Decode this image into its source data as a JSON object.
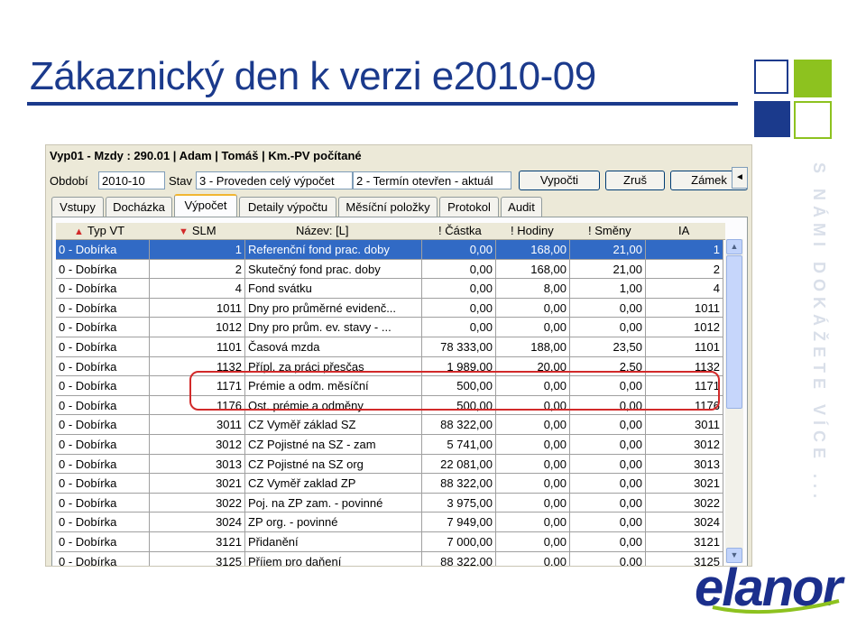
{
  "slide": {
    "title": "Zákaznický den k verzi e2010-09",
    "side_text": "S NÁMI DOKÁŽETE VÍCE ...",
    "logo_text": "elanor",
    "colors": {
      "title": "#1b3a8c",
      "green": "#8dc21f",
      "navy": "#1b3a8c"
    }
  },
  "app": {
    "title": "Vyp01 - Mzdy : 290.01 | Adam | Tomáš | Km.-PV počítané",
    "period_label": "Období",
    "period_value": "2010-10",
    "state_label": "Stav",
    "state_value": "3 - Proveden celý výpočet",
    "term_value": "2 - Termín otevřen - aktuál",
    "buttons": {
      "calc": "Vypočti",
      "cancel": "Zruš",
      "lock": "Zámek"
    },
    "tabs": [
      "Vstupy",
      "Docházka",
      "Výpočet",
      "Detaily výpočtu",
      "Měsíční položky",
      "Protokol",
      "Audit"
    ],
    "active_tab": "Výpočet",
    "columns": [
      "Typ VT",
      "SLM",
      "Název: [L]",
      "! Částka",
      "! Hodiny",
      "! Směny",
      "IA"
    ],
    "rows": [
      [
        "0 - Dobírka",
        "1",
        "Referenční fond prac. doby",
        "0,00",
        "168,00",
        "21,00",
        "1"
      ],
      [
        "0 - Dobírka",
        "2",
        "Skutečný fond prac. doby",
        "0,00",
        "168,00",
        "21,00",
        "2"
      ],
      [
        "0 - Dobírka",
        "4",
        "Fond svátku",
        "0,00",
        "8,00",
        "1,00",
        "4"
      ],
      [
        "0 - Dobírka",
        "1011",
        "Dny pro průměrné evidenč...",
        "0,00",
        "0,00",
        "0,00",
        "1011"
      ],
      [
        "0 - Dobírka",
        "1012",
        "Dny pro prům. ev. stavy - ...",
        "0,00",
        "0,00",
        "0,00",
        "1012"
      ],
      [
        "0 - Dobírka",
        "1101",
        "Časová mzda",
        "78 333,00",
        "188,00",
        "23,50",
        "1101"
      ],
      [
        "0 - Dobírka",
        "1132",
        "Přípl. za práci přesčas",
        "1 989,00",
        "20,00",
        "2,50",
        "1132"
      ],
      [
        "0 - Dobírka",
        "1171",
        "Prémie a odm. měsíční",
        "500,00",
        "0,00",
        "0,00",
        "1171"
      ],
      [
        "0 - Dobírka",
        "1176",
        "Ost. prémie a odměny",
        "500,00",
        "0,00",
        "0,00",
        "1176"
      ],
      [
        "0 - Dobírka",
        "3011",
        "CZ Vyměř základ SZ",
        "88 322,00",
        "0,00",
        "0,00",
        "3011"
      ],
      [
        "0 - Dobírka",
        "3012",
        "CZ Pojistné na SZ - zam",
        "5 741,00",
        "0,00",
        "0,00",
        "3012"
      ],
      [
        "0 - Dobírka",
        "3013",
        "CZ Pojistné na SZ  org",
        "22 081,00",
        "0,00",
        "0,00",
        "3013"
      ],
      [
        "0 - Dobírka",
        "3021",
        "CZ Vyměř zaklad ZP",
        "88 322,00",
        "0,00",
        "0,00",
        "3021"
      ],
      [
        "0 - Dobírka",
        "3022",
        "Poj. na ZP zam. - povinné",
        "3 975,00",
        "0,00",
        "0,00",
        "3022"
      ],
      [
        "0 - Dobírka",
        "3024",
        "ZP org. - povinné",
        "7 949,00",
        "0,00",
        "0,00",
        "3024"
      ],
      [
        "0 - Dobírka",
        "3121",
        "Přidanění",
        "7 000,00",
        "0,00",
        "0,00",
        "3121"
      ],
      [
        "0 - Dobírka",
        "3125",
        "Příjem pro daňení",
        "88 322,00",
        "0,00",
        "0,00",
        "3125"
      ]
    ]
  }
}
